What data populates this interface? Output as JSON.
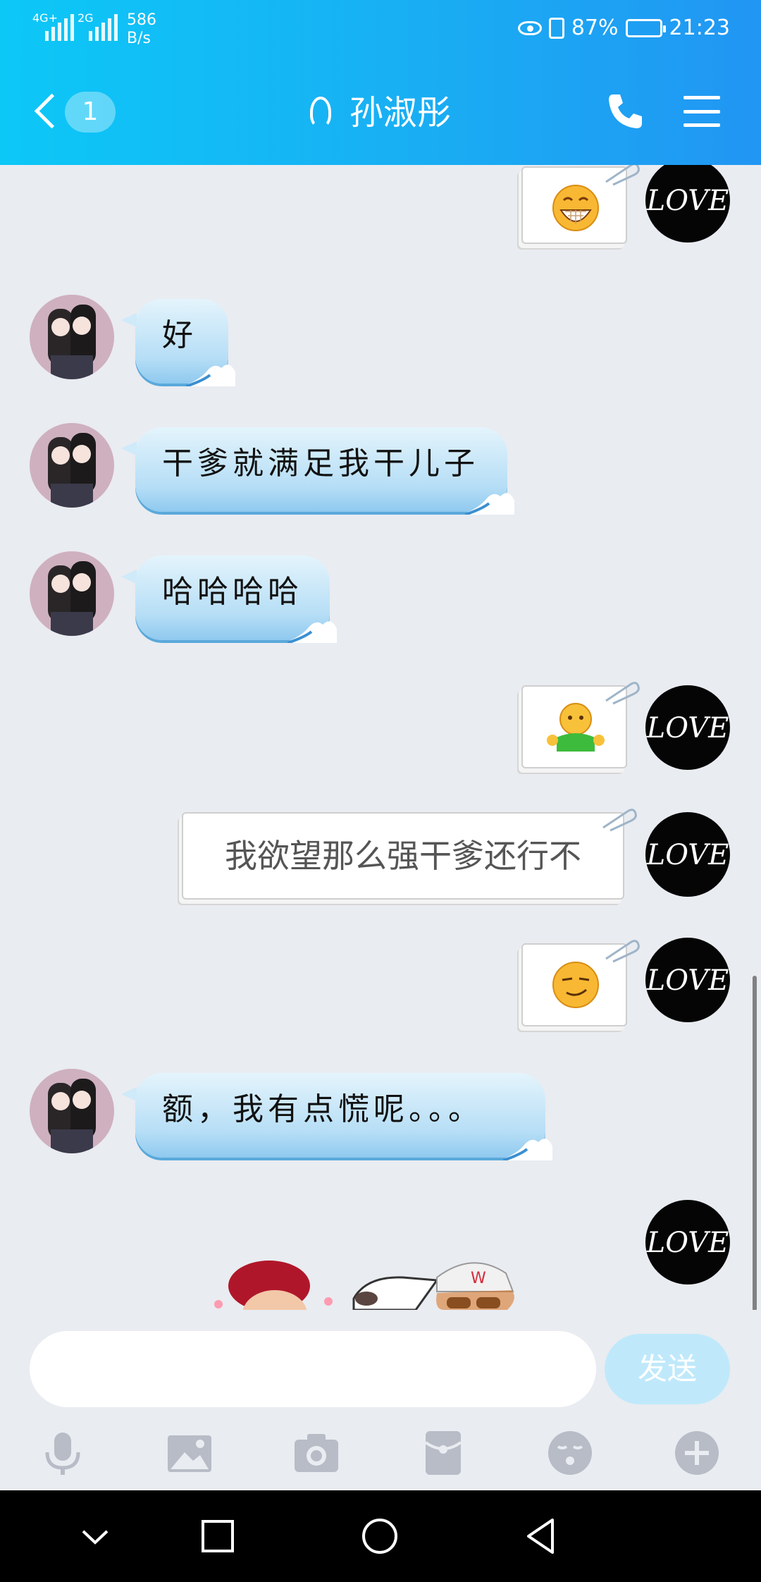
{
  "status_bar": {
    "network_1": "4G+",
    "network_2": "2G",
    "speed_value": "586",
    "speed_unit": "B/s",
    "battery": "87%",
    "time": "21:23"
  },
  "header": {
    "unread_count": "1",
    "contact_name": "孙淑彤",
    "icons": [
      "back-icon",
      "ear-icon",
      "phone-icon",
      "menu-icon"
    ]
  },
  "messages": [
    {
      "side": "right",
      "kind": "emoji",
      "emoji": "grinning-face"
    },
    {
      "side": "left",
      "kind": "text",
      "text": "好"
    },
    {
      "side": "left",
      "kind": "text",
      "text": "干爹就满足我干儿子"
    },
    {
      "side": "left",
      "kind": "text",
      "text": "哈哈哈哈"
    },
    {
      "side": "right",
      "kind": "emoji",
      "emoji": "hug-emoji"
    },
    {
      "side": "right",
      "kind": "text",
      "text": "我欲望那么强干爹还行不"
    },
    {
      "side": "right",
      "kind": "emoji",
      "emoji": "smirk-face"
    },
    {
      "side": "left",
      "kind": "text",
      "text": "额，我有点慌呢。。。"
    },
    {
      "side": "right",
      "kind": "sticker",
      "emoji": "cartoon-couple-sticker"
    }
  ],
  "input": {
    "placeholder": "",
    "send_label": "发送"
  },
  "toolbar": [
    "microphone-icon",
    "image-icon",
    "camera-icon",
    "red-packet-icon",
    "emoji-icon",
    "plus-icon"
  ],
  "colors": {
    "header_start": "#0cc8f7",
    "header_end": "#2196f3",
    "bubble_in": "#b6def6",
    "send_button": "#bfe9fb",
    "chat_bg": "#e9ecf1"
  }
}
